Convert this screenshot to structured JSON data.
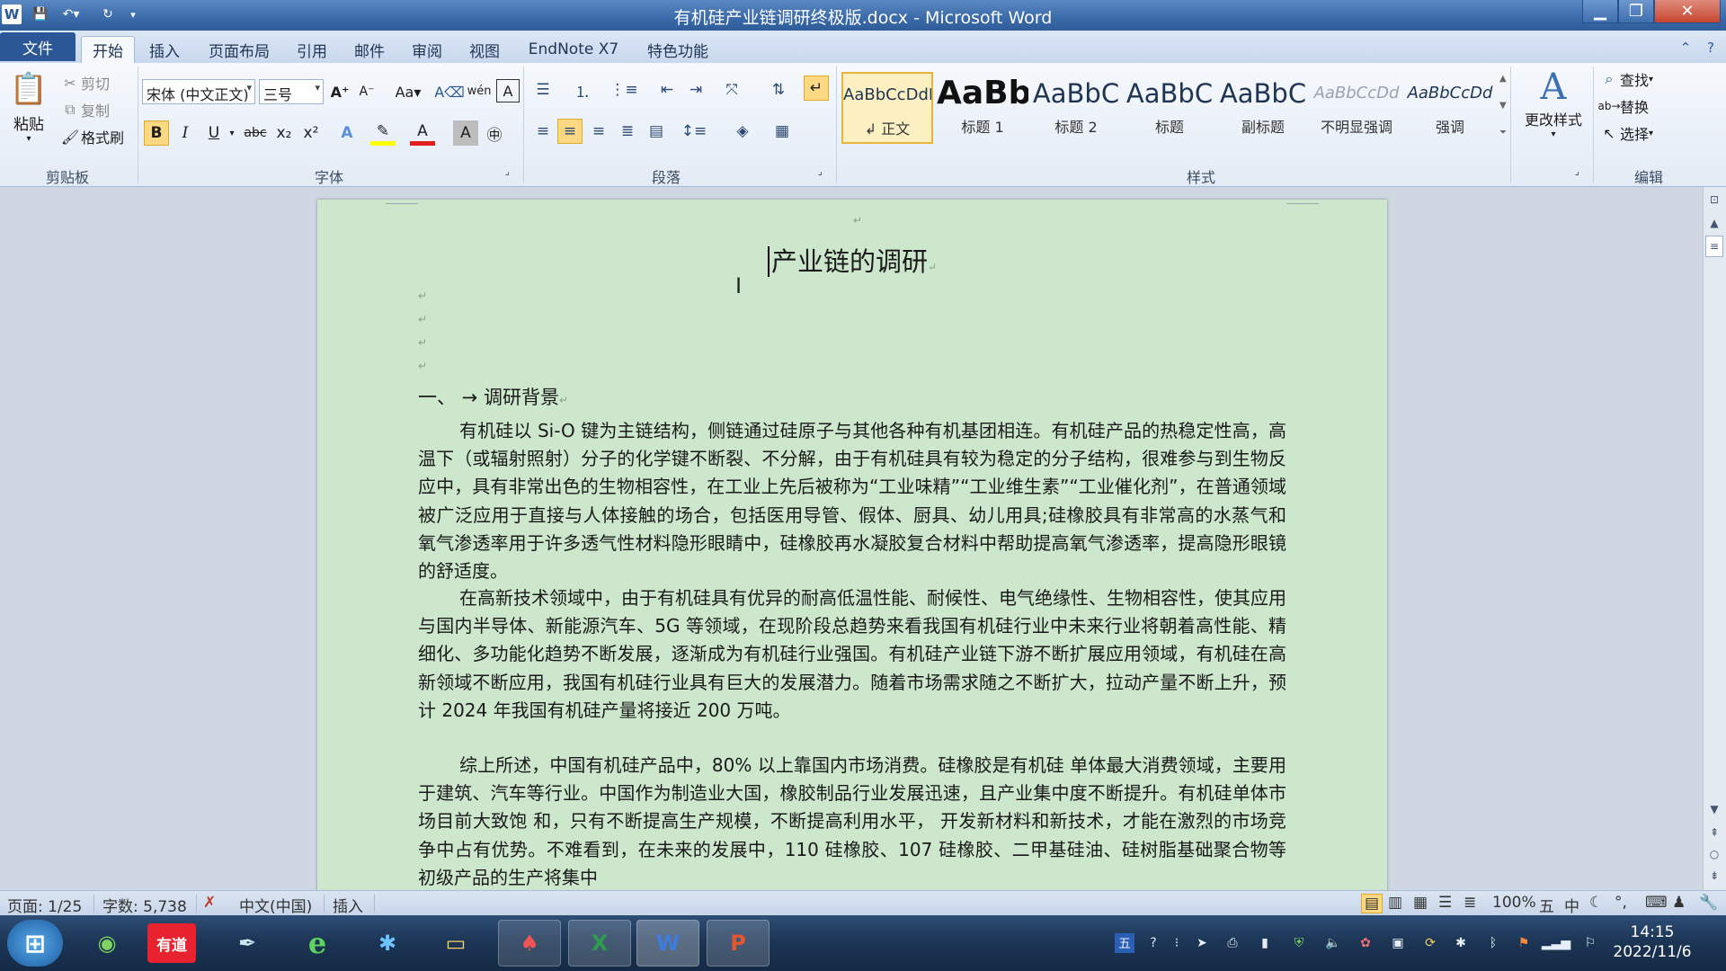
{
  "window": {
    "title": "有机硅产业链调研终极版.docx - Microsoft Word",
    "app_logo": "W"
  },
  "tabs": [
    {
      "label": "文件"
    },
    {
      "label": "开始"
    },
    {
      "label": "插入"
    },
    {
      "label": "页面布局"
    },
    {
      "label": "引用"
    },
    {
      "label": "邮件"
    },
    {
      "label": "审阅"
    },
    {
      "label": "视图"
    },
    {
      "label": "EndNote X7"
    },
    {
      "label": "特色功能"
    }
  ],
  "ribbon": {
    "clipboard": {
      "paste": "粘贴",
      "cut": "剪切",
      "copy": "复制",
      "format_painter": "格式刷",
      "group_label": "剪贴板"
    },
    "font": {
      "font_name": "宋体 (中文正文)",
      "font_size": "三号",
      "group_label": "字体",
      "bold": "B",
      "italic": "I",
      "underline": "U",
      "strike": "abc",
      "change_case": "Aa"
    },
    "paragraph": {
      "group_label": "段落"
    },
    "styles": {
      "group_label": "样式",
      "change_styles": "更改样式",
      "items": [
        {
          "sample": "AaBbCcDdI",
          "name": "↲ 正文"
        },
        {
          "sample": "AaBb",
          "name": "标题 1"
        },
        {
          "sample": "AaBbC",
          "name": "标题 2"
        },
        {
          "sample": "AaBbC",
          "name": "标题"
        },
        {
          "sample": "AaBbC",
          "name": "副标题"
        },
        {
          "sample": "AaBbCcDd",
          "name": "不明显强调"
        },
        {
          "sample": "AaBbCcDd",
          "name": "强调"
        }
      ]
    },
    "editing": {
      "find": "查找",
      "replace": "替换",
      "select": "选择",
      "group_label": "编辑"
    }
  },
  "document": {
    "title": "产业链的调研",
    "heading1": "一、 → 调研背景",
    "paragraphs": [
      "有机硅以 Si-O 键为主链结构，侧链通过硅原子与其他各种有机基团相连。有机硅产品的热稳定性高，高温下（或辐射照射）分子的化学键不断裂、不分解，由于有机硅具有较为稳定的分子结构，很难参与到生物反应中，具有非常出色的生物相容性，在工业上先后被称为“工业味精”“工业维生素”“工业催化剂”，在普通领域被广泛应用于直接与人体接触的场合，包括医用导管、假体、厨具、幼儿用具;硅橡胶具有非常高的水蒸气和氧气渗透率用于许多透气性材料隐形眼睛中，硅橡胶再水凝胶复合材料中帮助提高氧气渗透率，提高隐形眼镜的舒适度。",
      "在高新技术领域中，由于有机硅具有优异的耐高低温性能、耐候性、电气绝缘性、生物相容性，使其应用与国内半导体、新能源汽车、5G 等领域，在现阶段总趋势来看我国有机硅行业中未来行业将朝着高性能、精细化、多功能化趋势不断发展，逐渐成为有机硅行业强国。有机硅产业链下游不断扩展应用领域，有机硅在高新领域不断应用，我国有机硅行业具有巨大的发展潜力。随着市场需求随之不断扩大，拉动产量不断上升，预计 2024 年我国有机硅产量将接近 200 万吨。",
      "综上所述，中国有机硅产品中，80% 以上靠国内市场消费。硅橡胶是有机硅 单体最大消费领域，主要用于建筑、汽车等行业。中国作为制造业大国，橡胶制品行业发展迅速，且产业集中度不断提升。有机硅单体市场目前大致饱 和，只有不断提高生产规模，不断提高利用水平， 开发新材料和新技术，才能在激烈的市场竞争中占有优势。不难看到，在未来的发展中，110 硅橡胶、107 硅橡胶、二甲基硅油、硅树脂基础聚合物等初级产品的生产将集中"
    ]
  },
  "statusbar": {
    "page": "页面: 1/25",
    "words": "字数: 5,738",
    "language": "中文(中国)",
    "mode": "插入",
    "zoom": "100%"
  },
  "taskbar": {
    "apps": [
      {
        "name": "start",
        "label": "⊞"
      },
      {
        "name": "browser-360",
        "label": "◉"
      },
      {
        "name": "youdao",
        "label": "有道"
      },
      {
        "name": "feather",
        "label": "✒"
      },
      {
        "name": "ie",
        "label": "e"
      },
      {
        "name": "pin",
        "label": "✱"
      },
      {
        "name": "explorer",
        "label": "▭"
      },
      {
        "name": "cards",
        "label": "♠"
      },
      {
        "name": "excel",
        "label": "X"
      },
      {
        "name": "word",
        "label": "W"
      },
      {
        "name": "powerpoint",
        "label": "P"
      }
    ],
    "clock_time": "14:15",
    "clock_date": "2022/11/6",
    "ime": "五"
  },
  "colors": {
    "page_bg": "#cde7cd",
    "accent": "#2b579a",
    "selected_style": "#fcefc2"
  }
}
